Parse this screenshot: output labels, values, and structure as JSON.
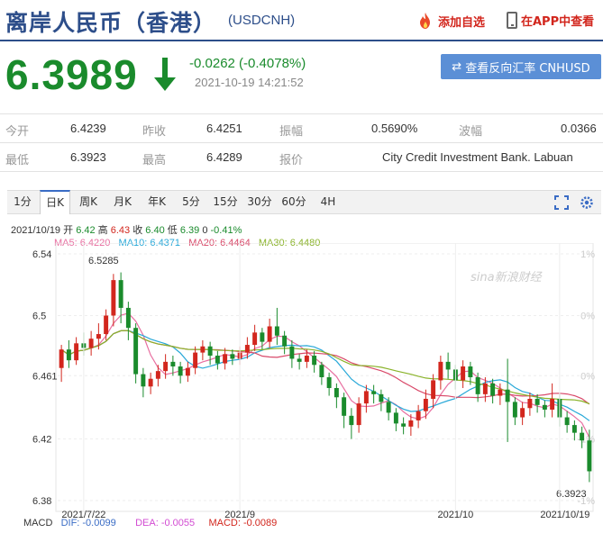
{
  "header": {
    "title": "离岸人民币（香港）",
    "code": "(USDCNH)",
    "add_label": "添加自选",
    "app_label": "在APP中查看"
  },
  "quote": {
    "price": "6.3989",
    "change": "-0.0262 (-0.4078%)",
    "time": "2021-10-19 14:21:52",
    "reverse_label": "查看反向汇率 CNHUSD"
  },
  "stats": {
    "rows": [
      [
        {
          "label": "今开",
          "value": "6.4239"
        },
        {
          "label": "昨收",
          "value": "6.4251"
        },
        {
          "label": "振幅",
          "value": "0.5690%"
        },
        {
          "label": "波幅",
          "value": "0.0366"
        }
      ],
      [
        {
          "label": "最低",
          "value": "6.3923"
        },
        {
          "label": "最高",
          "value": "6.4289"
        },
        {
          "label": "报价",
          "value": "City Credit Investment Bank. Labuan"
        }
      ]
    ]
  },
  "tabs": [
    "1分",
    "日K",
    "周K",
    "月K",
    "年K",
    "5分",
    "15分",
    "30分",
    "60分",
    "4H"
  ],
  "active_tab": "日K",
  "ohlc_line": {
    "date": "2021/10/19",
    "open_label": "开",
    "open": "6.42",
    "high_label": "高",
    "high": "6.43",
    "close_label": "收",
    "close": "6.40",
    "low_label": "低",
    "low": "6.39",
    "vol": "0",
    "pct": "-0.41%"
  },
  "ma": {
    "ma5": "MA5: 6.4220",
    "ma10": "MA10: 6.4371",
    "ma20": "MA20: 6.4464",
    "ma30": "MA30: 6.4480"
  },
  "macd": {
    "label": "MACD",
    "dif": "DIF: -0.0099",
    "dea": "DEA: -0.0055",
    "macd": "MACD: -0.0089"
  },
  "colors": {
    "up": "#d2261d",
    "down": "#1a8b2c",
    "ma5": "#e86ea0",
    "ma10": "#28a8d8",
    "ma20": "#d94a6a",
    "ma30": "#8ab32a",
    "brand": "#2d4e8a"
  },
  "chart_data": {
    "type": "candlestick",
    "ylim": [
      6.38,
      6.54
    ],
    "y_ticks": [
      "6.54",
      "6.5",
      "6.461",
      "6.42",
      "6.38"
    ],
    "pct_ticks": [
      "1%",
      "0%",
      "0%",
      "-1%",
      "-1%"
    ],
    "x_ticks": [
      "2021/7/22",
      "2021/9",
      "2021/10",
      "2021/10/19"
    ],
    "annotations": {
      "high": "6.5285",
      "low": "6.3923"
    },
    "watermark": "sina新浪财经",
    "candles": [
      [
        6.466,
        6.478,
        6.461,
        6.457,
        6.481
      ],
      [
        6.478,
        6.471,
        6.472,
        6.466,
        6.484
      ],
      [
        6.471,
        6.482,
        6.468,
        6.468,
        6.486
      ],
      [
        6.482,
        6.479,
        6.478,
        6.474,
        6.489
      ],
      [
        6.479,
        6.485,
        6.476,
        6.474,
        6.49
      ],
      [
        6.485,
        6.488,
        6.48,
        6.478,
        6.495
      ],
      [
        6.488,
        6.5,
        6.484,
        6.484,
        6.504
      ],
      [
        6.5,
        6.523,
        6.496,
        6.493,
        6.527
      ],
      [
        6.523,
        6.505,
        6.501,
        6.495,
        6.528
      ],
      [
        6.505,
        6.492,
        6.488,
        6.484,
        6.509
      ],
      [
        6.492,
        6.462,
        6.459,
        6.456,
        6.495
      ],
      [
        6.462,
        6.454,
        6.451,
        6.447,
        6.466
      ],
      [
        6.454,
        6.459,
        6.452,
        6.449,
        6.463
      ],
      [
        6.459,
        6.464,
        6.457,
        6.454,
        6.468
      ],
      [
        6.464,
        6.47,
        6.462,
        6.459,
        6.475
      ],
      [
        6.47,
        6.467,
        6.465,
        6.461,
        6.474
      ],
      [
        6.467,
        6.461,
        6.459,
        6.456,
        6.47
      ],
      [
        6.461,
        6.466,
        6.459,
        6.457,
        6.47
      ],
      [
        6.466,
        6.476,
        6.464,
        6.462,
        6.48
      ],
      [
        6.476,
        6.48,
        6.474,
        6.471,
        6.484
      ],
      [
        6.48,
        6.474,
        6.471,
        6.468,
        6.483
      ],
      [
        6.474,
        6.469,
        6.468,
        6.465,
        6.477
      ],
      [
        6.469,
        6.475,
        6.467,
        6.465,
        6.479
      ],
      [
        6.475,
        6.472,
        6.47,
        6.468,
        6.478
      ],
      [
        6.472,
        6.476,
        6.47,
        6.468,
        6.48
      ],
      [
        6.476,
        6.481,
        6.474,
        6.472,
        6.486
      ],
      [
        6.481,
        6.489,
        6.479,
        6.477,
        6.494
      ],
      [
        6.489,
        6.483,
        6.481,
        6.478,
        6.492
      ],
      [
        6.483,
        6.493,
        6.481,
        6.479,
        6.498
      ],
      [
        6.493,
        6.487,
        6.484,
        6.481,
        6.505
      ],
      [
        6.487,
        6.48,
        6.478,
        6.475,
        6.49
      ],
      [
        6.48,
        6.472,
        6.47,
        6.466,
        6.484
      ],
      [
        6.472,
        6.47,
        6.468,
        6.465,
        6.475
      ],
      [
        6.47,
        6.474,
        6.468,
        6.466,
        6.478
      ],
      [
        6.474,
        6.468,
        6.466,
        6.463,
        6.477
      ],
      [
        6.468,
        6.46,
        6.458,
        6.455,
        6.47
      ],
      [
        6.46,
        6.453,
        6.451,
        6.448,
        6.463
      ],
      [
        6.453,
        6.447,
        6.444,
        6.44,
        6.456
      ],
      [
        6.447,
        6.435,
        6.432,
        6.427,
        6.45
      ],
      [
        6.435,
        6.429,
        6.424,
        6.42,
        6.44
      ],
      [
        6.429,
        6.443,
        6.427,
        6.424,
        6.447
      ],
      [
        6.443,
        6.451,
        6.44,
        6.437,
        6.455
      ],
      [
        6.451,
        6.449,
        6.447,
        6.443,
        6.455
      ],
      [
        6.449,
        6.444,
        6.442,
        6.438,
        6.452
      ],
      [
        6.444,
        6.437,
        6.435,
        6.432,
        6.447
      ],
      [
        6.437,
        6.43,
        6.428,
        6.425,
        6.44
      ],
      [
        6.43,
        6.428,
        6.426,
        6.423,
        6.434
      ],
      [
        6.428,
        6.432,
        6.425,
        6.422,
        6.436
      ],
      [
        6.432,
        6.438,
        6.43,
        6.427,
        6.442
      ],
      [
        6.438,
        6.446,
        6.436,
        6.433,
        6.452
      ],
      [
        6.446,
        6.458,
        6.443,
        6.44,
        6.462
      ],
      [
        6.458,
        6.47,
        6.455,
        6.452,
        6.474
      ],
      [
        6.47,
        6.465,
        6.463,
        6.459,
        6.476
      ],
      [
        6.465,
        6.458,
        6.456,
        6.452,
        6.468
      ],
      [
        6.458,
        6.467,
        6.456,
        6.453,
        6.471
      ],
      [
        6.467,
        6.46,
        6.458,
        6.455,
        6.47
      ],
      [
        6.46,
        6.449,
        6.447,
        6.444,
        6.463
      ],
      [
        6.449,
        6.456,
        6.447,
        6.444,
        6.46
      ],
      [
        6.456,
        6.448,
        6.446,
        6.443,
        6.459
      ],
      [
        6.448,
        6.452,
        6.446,
        6.442,
        6.456
      ],
      [
        6.452,
        6.444,
        6.442,
        6.418,
        6.472
      ],
      [
        6.444,
        6.434,
        6.432,
        6.429,
        6.447
      ],
      [
        6.434,
        6.44,
        6.432,
        6.429,
        6.444
      ],
      [
        6.44,
        6.446,
        6.438,
        6.435,
        6.45
      ],
      [
        6.446,
        6.442,
        6.44,
        6.437,
        6.449
      ],
      [
        6.442,
        6.439,
        6.437,
        6.434,
        6.445
      ],
      [
        6.439,
        6.446,
        6.437,
        6.434,
        6.456
      ],
      [
        6.446,
        6.434,
        6.432,
        6.428,
        6.449
      ],
      [
        6.434,
        6.429,
        6.427,
        6.424,
        6.438
      ],
      [
        6.429,
        6.424,
        6.422,
        6.419,
        6.432
      ],
      [
        6.424,
        6.419,
        6.417,
        6.414,
        6.428
      ],
      [
        6.419,
        6.399,
        6.397,
        6.392,
        6.426
      ]
    ]
  }
}
